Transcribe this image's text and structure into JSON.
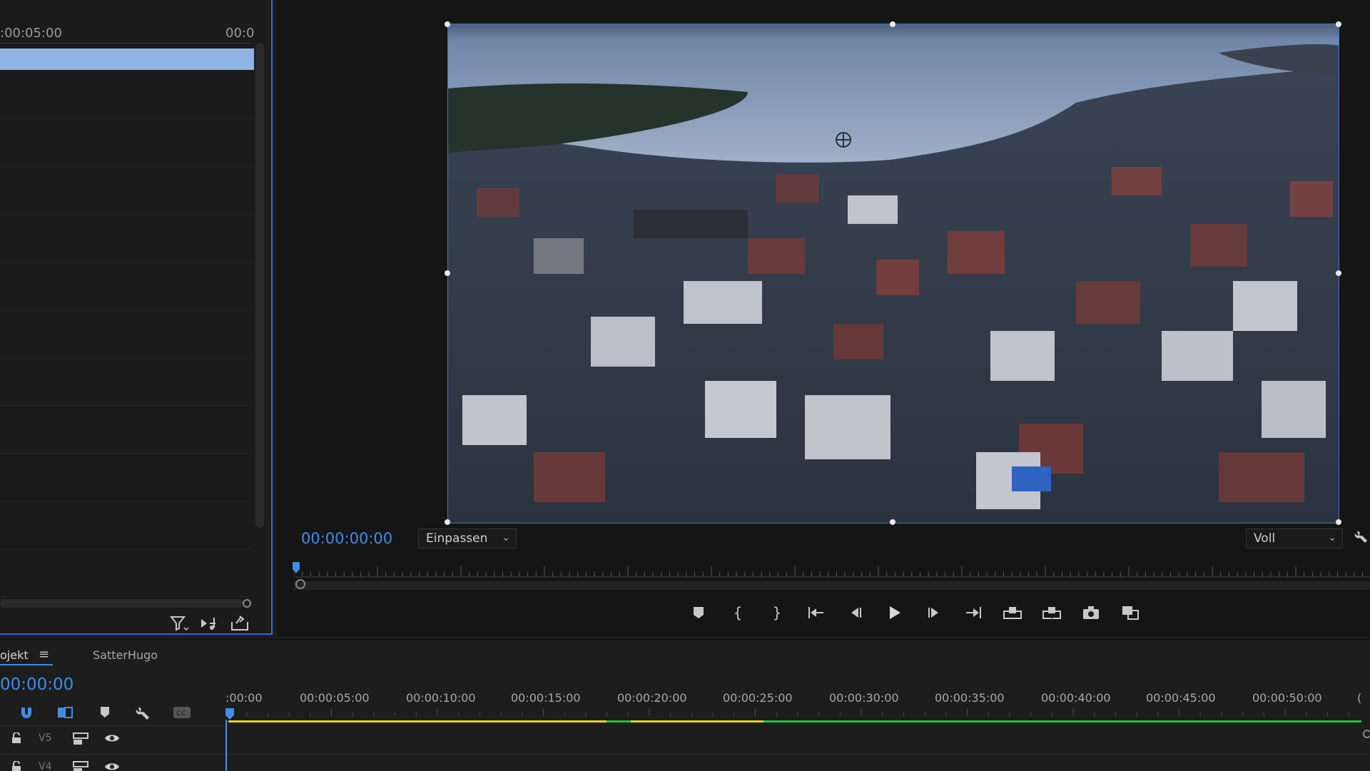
{
  "source_panel": {
    "ruler_labels": [
      ":00:05:00",
      "00:0"
    ]
  },
  "monitor": {
    "timecode": "00:00:00:00",
    "fit_dropdown": "Einpassen",
    "quality_dropdown": "Voll"
  },
  "timeline": {
    "tabs": [
      {
        "label": "ojekt"
      },
      {
        "label": "SatterHugo"
      }
    ],
    "timecode": "00:00:00",
    "ruler_labels": [
      ":00:00",
      "00:00:05:00",
      "00:00:10:00",
      "00:00:15:00",
      "00:00:20:00",
      "00:00:25:00",
      "00:00:30:00",
      "00:00:35:00",
      "00:00:40:00",
      "00:00:45:00",
      "00:00:50:00",
      "("
    ],
    "tracks": [
      {
        "label": "V5"
      },
      {
        "label": "V4"
      }
    ]
  },
  "colors": {
    "accent": "#3f8ee6",
    "panel_border": "#2f6bd1",
    "clip_blue": "#8fb4e3",
    "render_yellow": "#e6d41a",
    "render_green": "#20c040"
  }
}
